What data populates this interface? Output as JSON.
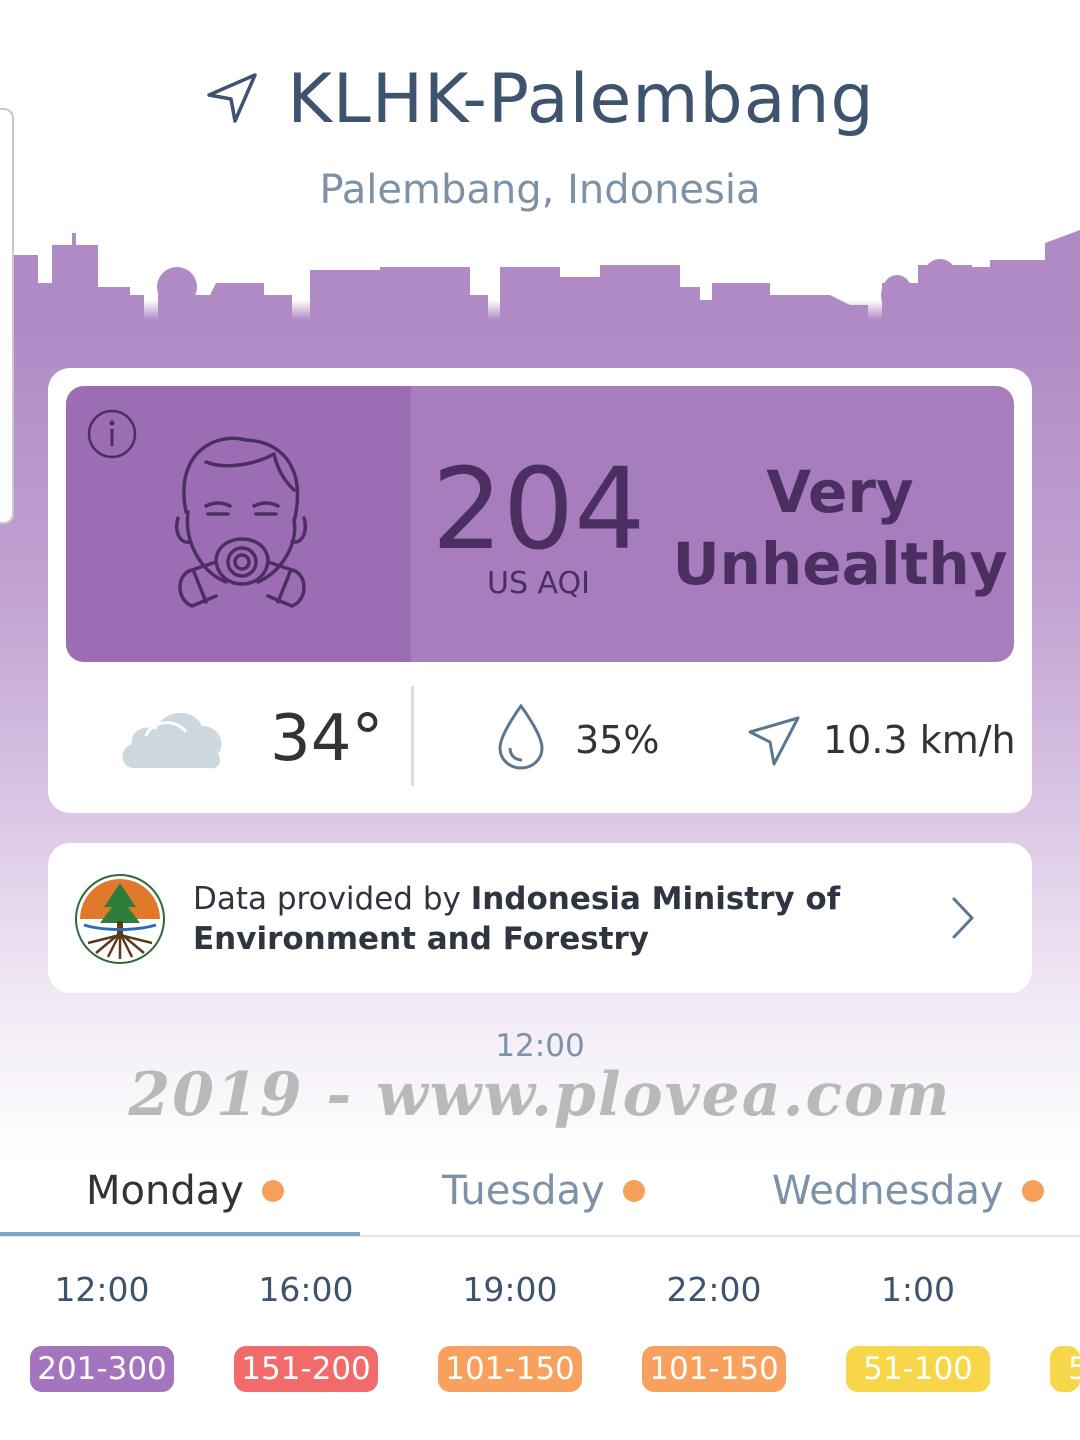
{
  "header": {
    "station": "KLHK-Palembang",
    "location": "Palembang, Indonesia"
  },
  "aqi": {
    "value": "204",
    "unit": "US AQI",
    "status_line1": "Very",
    "status_line2": "Unhealthy",
    "color": "#a87dbe"
  },
  "weather": {
    "temperature": "34°",
    "humidity": "35%",
    "wind": "10.3 km/h"
  },
  "provider": {
    "prefix": "Data provided by ",
    "name": "Indonesia Ministry of Environment and Forestry"
  },
  "current_time": "12:00",
  "watermark": "2019 - www.plovea.com",
  "days": [
    {
      "label": "Monday",
      "active": true
    },
    {
      "label": "Tuesday",
      "active": false
    },
    {
      "label": "Wednesday",
      "active": false
    }
  ],
  "forecast": [
    {
      "time": "12:00",
      "range": "201-300",
      "color": "#a474be"
    },
    {
      "time": "16:00",
      "range": "151-200",
      "color": "#f26b6b"
    },
    {
      "time": "19:00",
      "range": "101-150",
      "color": "#f8a15e"
    },
    {
      "time": "22:00",
      "range": "101-150",
      "color": "#f8a15e"
    },
    {
      "time": "1:00",
      "range": "51-100",
      "color": "#f7d64a"
    },
    {
      "time": "",
      "range": "5",
      "color": "#f7d64a"
    }
  ]
}
